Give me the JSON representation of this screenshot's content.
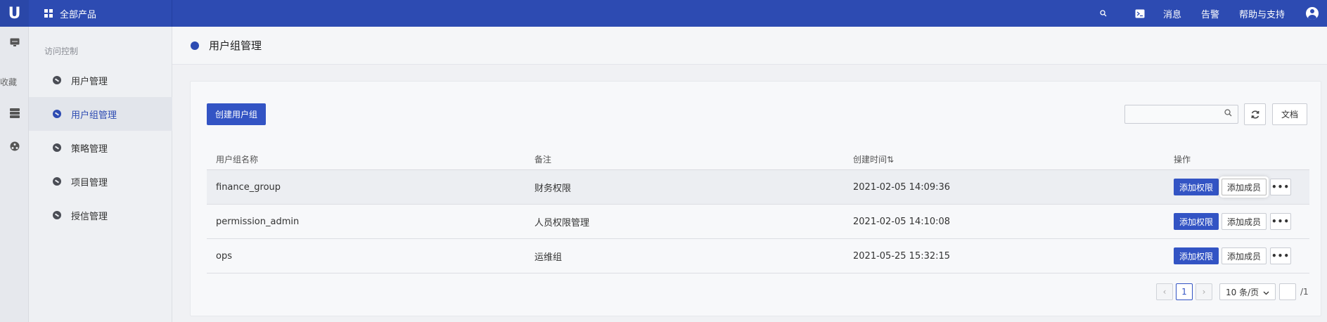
{
  "topbar": {
    "logo": "U",
    "products_label": "全部产品",
    "messages": "消息",
    "alerts": "告警",
    "help": "帮助与支持",
    "icons": [
      "search-icon",
      "terminal-icon",
      "user-avatar-icon"
    ]
  },
  "rail": {
    "favorites": "收藏",
    "icons": [
      "monitor-icon",
      "server-icon",
      "network-icon"
    ]
  },
  "sidebar": {
    "title": "访问控制",
    "items": [
      {
        "label": "用户管理"
      },
      {
        "label": "用户组管理"
      },
      {
        "label": "策略管理"
      },
      {
        "label": "项目管理"
      },
      {
        "label": "授信管理"
      }
    ],
    "active_index": 1
  },
  "page": {
    "title": "用户组管理"
  },
  "toolbar": {
    "create_label": "创建用户组",
    "search_placeholder": "",
    "doc_label": "文档"
  },
  "table": {
    "columns": [
      "用户组名称",
      "备注",
      "创建时间⇅",
      "操作"
    ],
    "rows": [
      {
        "name": "finance_group",
        "remark": "财务权限",
        "created": "2021-02-05 14:09:36"
      },
      {
        "name": "permission_admin",
        "remark": "人员权限管理",
        "created": "2021-02-05 14:10:08"
      },
      {
        "name": "ops",
        "remark": "运维组",
        "created": "2021-05-25 15:32:15"
      }
    ],
    "actions": {
      "add_permission": "添加权限",
      "add_member": "添加成员",
      "more": "•••"
    }
  },
  "pagination": {
    "prev": "‹",
    "current_page": "1",
    "next": "›",
    "page_size": "10 条/页",
    "total_pages": "/1"
  },
  "colors": {
    "brand": "#2d4bb2",
    "primary_button": "#3354c4"
  }
}
